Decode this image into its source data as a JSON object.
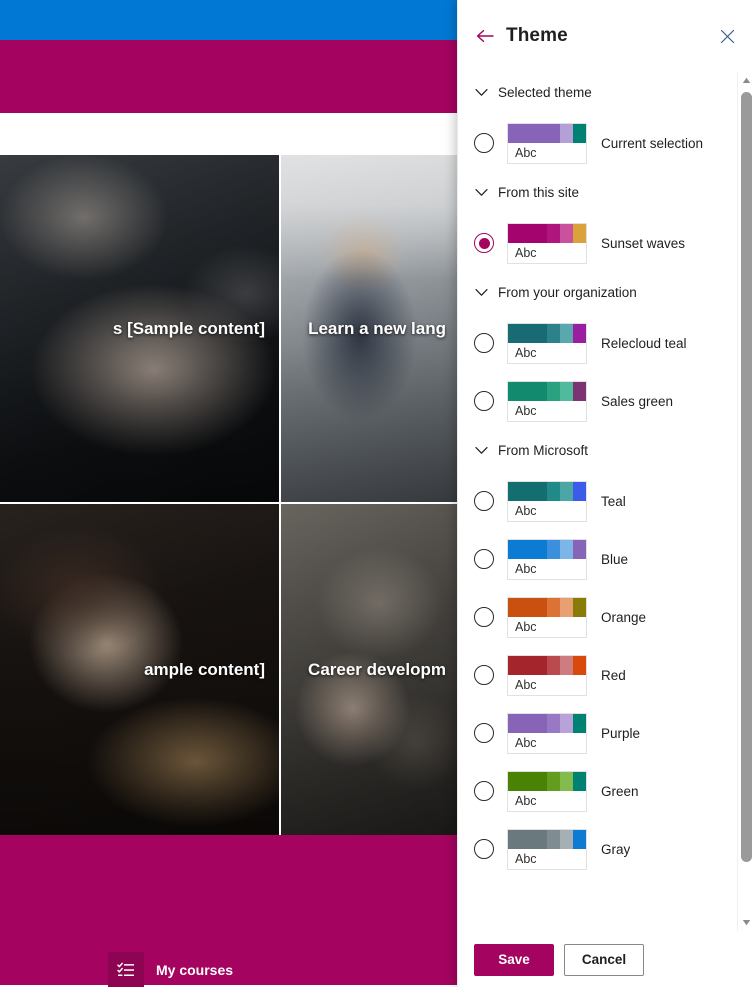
{
  "site": {
    "topbar_color": "#0078d4",
    "hero_color": "#a4045f",
    "tiles": [
      {
        "caption": "s [Sample content]",
        "photo": "handshake-photo"
      },
      {
        "caption": "Learn a new lang",
        "photo": "office-meeting-photo"
      },
      {
        "caption": "ample content]",
        "photo": "desk-working-photo"
      },
      {
        "caption": "Career developm",
        "photo": "hands-together-photo"
      }
    ],
    "footer": {
      "link_label": "My courses",
      "link_icon": "checklist-icon",
      "background_color": "#a4045f"
    }
  },
  "panel": {
    "title": "Theme",
    "back_icon": "back-arrow-icon",
    "close_icon": "close-icon",
    "accent_color": "#a4045f",
    "groups": [
      {
        "label": "Selected theme",
        "chevron": "chevron-down-icon",
        "themes": [
          {
            "name": "Current selection",
            "selected": false,
            "sample_text": "Abc",
            "colors": [
              "#8764b8",
              "#8764b8",
              "#b4a0d6",
              "#008272"
            ]
          }
        ]
      },
      {
        "label": "From this site",
        "chevron": "chevron-down-icon",
        "themes": [
          {
            "name": "Sunset waves",
            "selected": true,
            "sample_text": "Abc",
            "colors": [
              "#a4046e",
              "#b0157e",
              "#c9519e",
              "#d9a23a"
            ]
          }
        ]
      },
      {
        "label": "From your organization",
        "chevron": "chevron-down-icon",
        "themes": [
          {
            "name": "Relecloud teal",
            "selected": false,
            "sample_text": "Abc",
            "colors": [
              "#186b72",
              "#2d8189",
              "#5aa8ad",
              "#9c1ea0"
            ]
          },
          {
            "name": "Sales green",
            "selected": false,
            "sample_text": "Abc",
            "colors": [
              "#128a6e",
              "#2aa181",
              "#4fbb9c",
              "#7c3273"
            ]
          }
        ]
      },
      {
        "label": "From Microsoft",
        "chevron": "chevron-down-icon",
        "themes": [
          {
            "name": "Teal",
            "selected": false,
            "sample_text": "Abc",
            "colors": [
              "#136f6f",
              "#1f8a87",
              "#4aa7a5",
              "#3a5ce8"
            ]
          },
          {
            "name": "Blue",
            "selected": false,
            "sample_text": "Abc",
            "colors": [
              "#0b7bd4",
              "#3b8fdd",
              "#7cb5e8",
              "#8764b8"
            ]
          },
          {
            "name": "Orange",
            "selected": false,
            "sample_text": "Abc",
            "colors": [
              "#ca5010",
              "#dd7236",
              "#e8a072",
              "#8a7a06"
            ]
          },
          {
            "name": "Red",
            "selected": false,
            "sample_text": "Abc",
            "colors": [
              "#a4262c",
              "#bb4a4e",
              "#cd7d80",
              "#d8490b"
            ]
          },
          {
            "name": "Purple",
            "selected": false,
            "sample_text": "Abc",
            "colors": [
              "#8764b8",
              "#9a79c4",
              "#b9a2da",
              "#008272"
            ]
          },
          {
            "name": "Green",
            "selected": false,
            "sample_text": "Abc",
            "colors": [
              "#498205",
              "#629d1f",
              "#83bb4e",
              "#008272"
            ]
          },
          {
            "name": "Gray",
            "selected": false,
            "sample_text": "Abc",
            "colors": [
              "#69797e",
              "#7f8d92",
              "#a6b0b4",
              "#0b7bd4"
            ]
          }
        ]
      }
    ],
    "footer": {
      "save_label": "Save",
      "cancel_label": "Cancel"
    },
    "scrollbar": {
      "up_arrow": "scroll-up-arrow-icon",
      "down_arrow": "scroll-down-arrow-icon"
    }
  }
}
